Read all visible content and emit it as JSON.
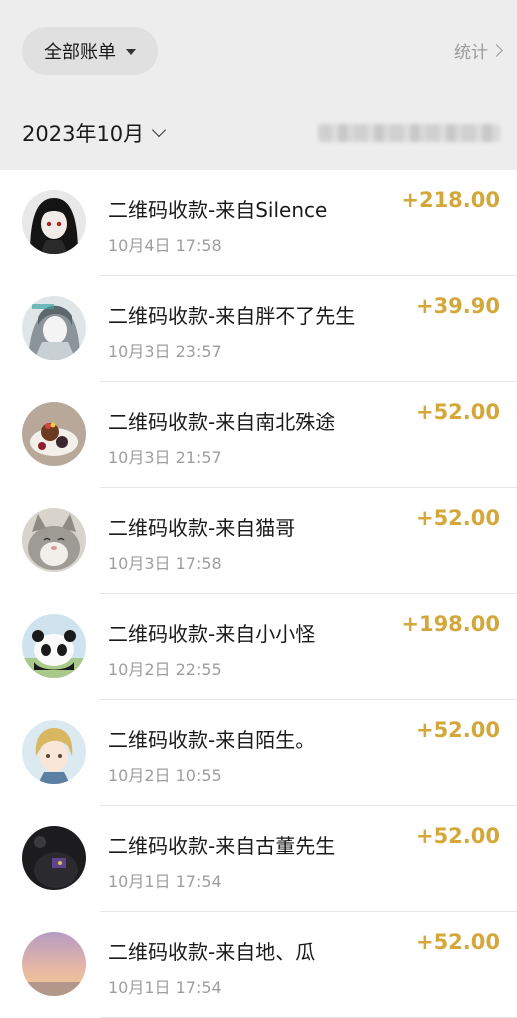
{
  "header": {
    "filter_label": "全部账单",
    "stats_label": "统计",
    "month_label": "2023年10月"
  },
  "colors": {
    "amount": "#d4a73a",
    "header_bg": "#ededed"
  },
  "transactions": [
    {
      "title": "二维码收款-来自Silence",
      "time": "10月4日 17:58",
      "amount": "+218.00",
      "avatar": "avatar-anime-dark-hair"
    },
    {
      "title": "二维码收款-来自胖不了先生",
      "time": "10月3日 23:57",
      "amount": "+39.90",
      "avatar": "avatar-anime-grey"
    },
    {
      "title": "二维码收款-来自南北殊途",
      "time": "10月3日 21:57",
      "amount": "+52.00",
      "avatar": "avatar-food-plate"
    },
    {
      "title": "二维码收款-来自猫哥",
      "time": "10月3日 17:58",
      "amount": "+52.00",
      "avatar": "avatar-cat"
    },
    {
      "title": "二维码收款-来自小小怪",
      "time": "10月2日 22:55",
      "amount": "+198.00",
      "avatar": "avatar-panda"
    },
    {
      "title": "二维码收款-来自陌生。",
      "time": "10月2日 10:55",
      "amount": "+52.00",
      "avatar": "avatar-anime-blond"
    },
    {
      "title": "二维码收款-来自古董先生",
      "time": "10月1日 17:54",
      "amount": "+52.00",
      "avatar": "avatar-dark-photo"
    },
    {
      "title": "二维码收款-来自地、瓜",
      "time": "10月1日 17:54",
      "amount": "+52.00",
      "avatar": "avatar-sunset"
    }
  ]
}
